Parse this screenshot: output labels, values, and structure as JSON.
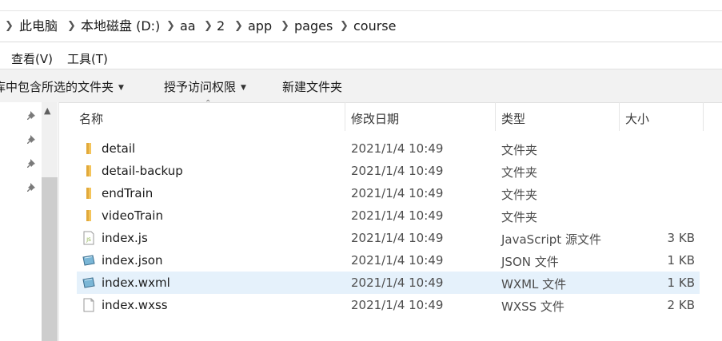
{
  "address": {
    "crumbs": [
      "此电脑",
      "本地磁盘 (D:)",
      "aa",
      "2",
      "app",
      "pages",
      "course"
    ]
  },
  "menu": {
    "view": "查看(V)",
    "tools": "工具(T)"
  },
  "commands": {
    "include_library": "库中包含所选的文件夹",
    "share_with": "授予访问权限",
    "new_folder": "新建文件夹"
  },
  "columns": {
    "name": "名称",
    "date": "修改日期",
    "type": "类型",
    "size": "大小"
  },
  "files": [
    {
      "name": "detail",
      "date": "2021/1/4 10:49",
      "type": "文件夹",
      "size": "",
      "icon": "folder-icon"
    },
    {
      "name": "detail-backup",
      "date": "2021/1/4 10:49",
      "type": "文件夹",
      "size": "",
      "icon": "folder-icon"
    },
    {
      "name": "endTrain",
      "date": "2021/1/4 10:49",
      "type": "文件夹",
      "size": "",
      "icon": "folder-icon"
    },
    {
      "name": "videoTrain",
      "date": "2021/1/4 10:49",
      "type": "文件夹",
      "size": "",
      "icon": "folder-icon"
    },
    {
      "name": "index.js",
      "date": "2021/1/4 10:49",
      "type": "JavaScript 源文件",
      "size": "3 KB",
      "icon": "js-file-icon"
    },
    {
      "name": "index.json",
      "date": "2021/1/4 10:49",
      "type": "JSON 文件",
      "size": "1 KB",
      "icon": "json-file-icon"
    },
    {
      "name": "index.wxml",
      "date": "2021/1/4 10:49",
      "type": "WXML 文件",
      "size": "1 KB",
      "icon": "wxml-file-icon"
    },
    {
      "name": "index.wxss",
      "date": "2021/1/4 10:49",
      "type": "WXSS 文件",
      "size": "2 KB",
      "icon": "blank-file-icon"
    }
  ],
  "selected_row": 6,
  "colors": {
    "selected_row": "#e5f1fb",
    "folder": "#e8b84a",
    "command_bar": "#f2f2f2"
  }
}
